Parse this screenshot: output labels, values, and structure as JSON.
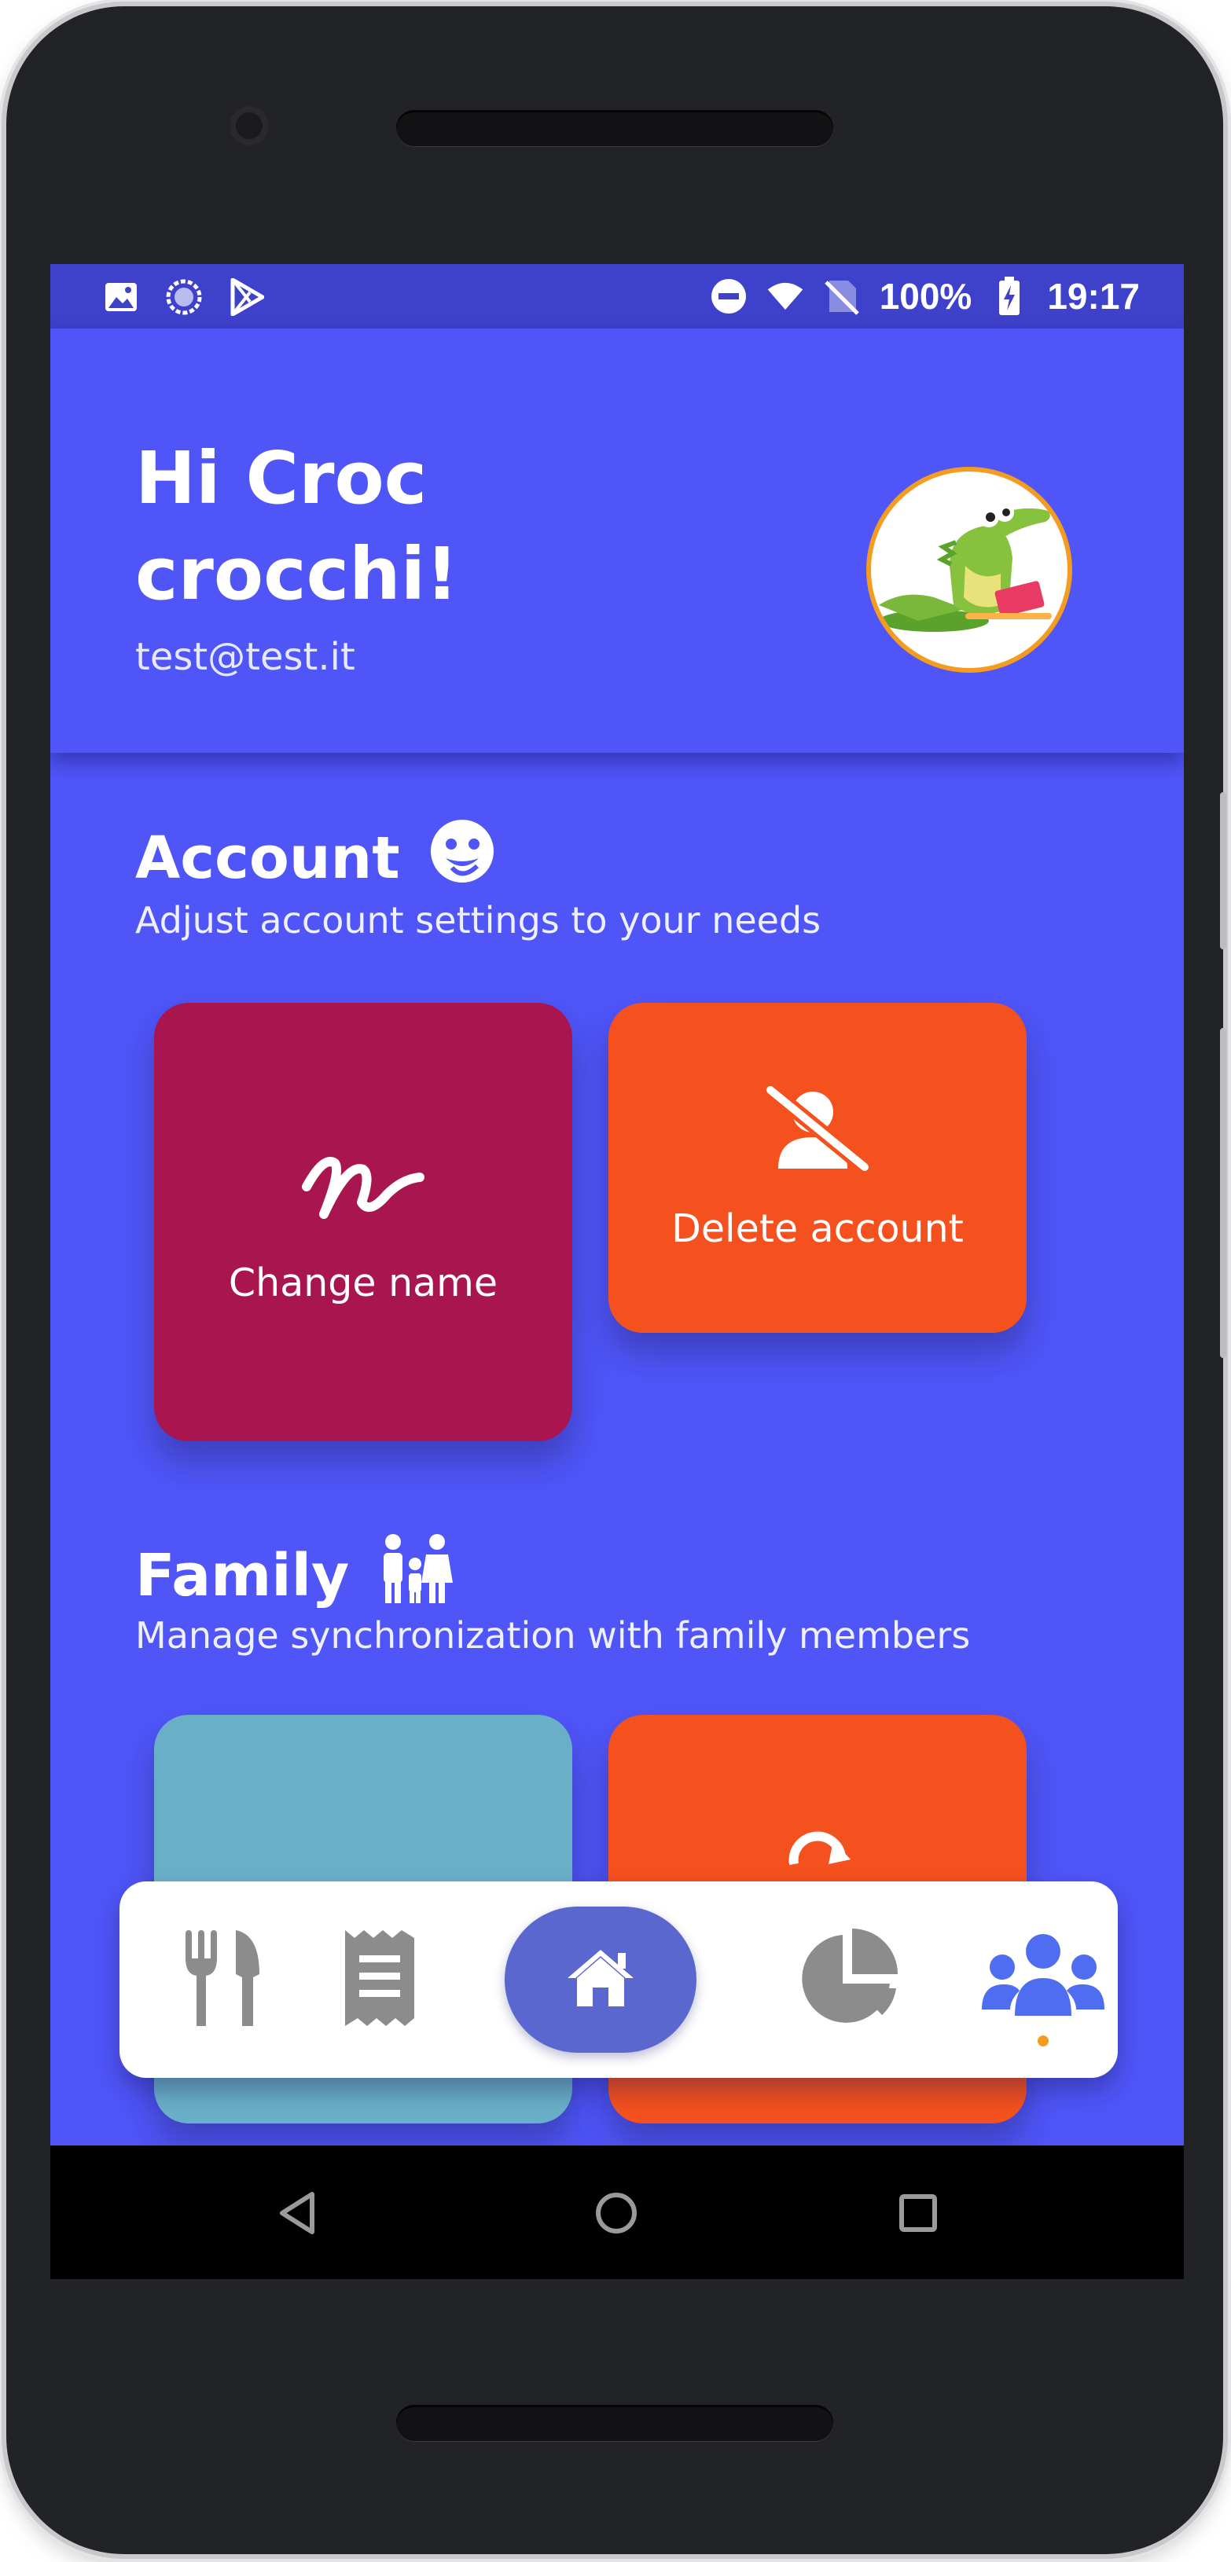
{
  "status_bar": {
    "battery": "100%",
    "time": "19:17",
    "left_icons": [
      "image-icon",
      "loading-icon",
      "play-store-icon"
    ],
    "right_icons": [
      "do-not-disturb-icon",
      "wifi-icon",
      "no-sim-icon",
      "battery-charging-icon"
    ]
  },
  "header": {
    "greeting": "Hi Croc crocchi!",
    "email": "test@test.it",
    "avatar_icon": "crocodile-avatar"
  },
  "account": {
    "title": "Account",
    "subtitle": "Adjust account settings to your needs",
    "icon": "face-icon",
    "cards": [
      {
        "label": "Change name",
        "icon": "signature-icon",
        "color": "#a8154f"
      },
      {
        "label": "Delete account",
        "icon": "user-slash-icon",
        "color": "#f4511e"
      }
    ]
  },
  "family": {
    "title": "Family",
    "subtitle": "Manage synchronization with family members",
    "icon": "family-icon",
    "cards": [
      {
        "color": "#6aafc8"
      },
      {
        "icon": "sync-icon",
        "color": "#f4511e"
      }
    ]
  },
  "bottom_nav": {
    "items": [
      "utensils-icon",
      "receipt-icon",
      "home-icon",
      "pie-chart-icon",
      "users-icon"
    ],
    "active": "users-icon",
    "accent": "#5a67ce",
    "indicator_color": "#f39c1f"
  },
  "colors": {
    "background": "#4f55f7",
    "status_bar": "#3e41c9"
  }
}
